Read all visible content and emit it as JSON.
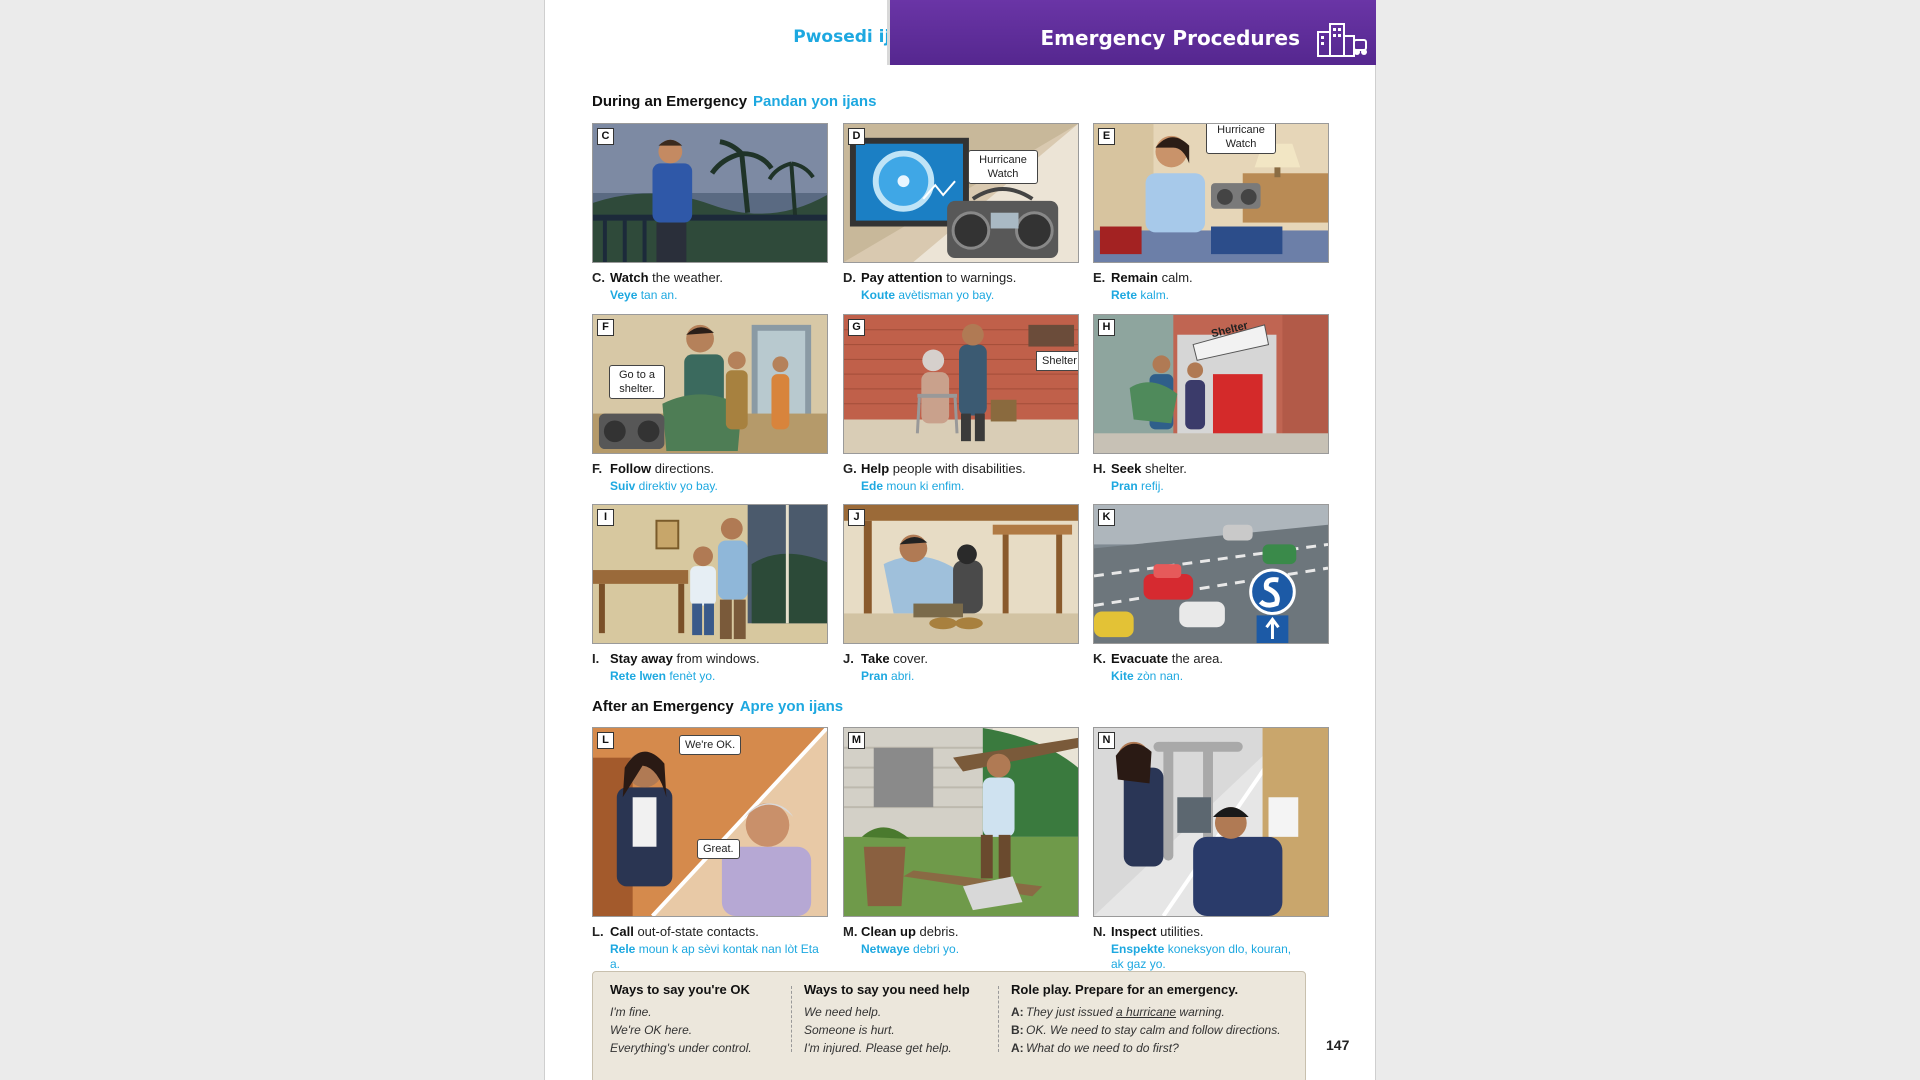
{
  "header": {
    "section_title_ht": "Pwosedi ijans",
    "section_title_en": "Emergency Procedures"
  },
  "during": {
    "title_en": "During an Emergency",
    "title_ht": "Pandan yon ijans"
  },
  "after": {
    "title_en": "After an Emergency",
    "title_ht": "Apre yon ijans"
  },
  "items": {
    "C": {
      "letter": "C",
      "label": "C.",
      "verb": "Watch",
      "rest": " the weather.",
      "verb_ht": "Veye",
      "rest_ht": " tan an."
    },
    "D": {
      "letter": "D",
      "label": "D.",
      "verb": "Pay attention",
      "rest": " to warnings.",
      "verb_ht": "Koute",
      "rest_ht": " avètisman yo bay.",
      "bubble": "Hurricane Watch"
    },
    "E": {
      "letter": "E",
      "label": "E.",
      "verb": "Remain",
      "rest": " calm.",
      "verb_ht": "Rete",
      "rest_ht": " kalm.",
      "bubble": "Hurricane Watch"
    },
    "F": {
      "letter": "F",
      "label": "F.",
      "verb": "Follow",
      "rest": " directions.",
      "verb_ht": "Suiv",
      "rest_ht": " direktiv yo bay.",
      "bubble": "Go to a shelter."
    },
    "G": {
      "letter": "G",
      "label": "G.",
      "verb": "Help",
      "rest": " people with disabilities.",
      "verb_ht": "Ede",
      "rest_ht": " moun ki enfim.",
      "sign": "Shelter"
    },
    "H": {
      "letter": "H",
      "label": "H.",
      "verb": "Seek",
      "rest": " shelter.",
      "verb_ht": "Pran",
      "rest_ht": " refij.",
      "sign": "Shelter"
    },
    "I": {
      "letter": "I",
      "label": "I.",
      "verb": "Stay away",
      "rest": " from windows.",
      "verb_ht": "Rete lwen",
      "rest_ht": " fenèt yo."
    },
    "J": {
      "letter": "J",
      "label": "J.",
      "verb": "Take",
      "rest": " cover.",
      "verb_ht": "Pran",
      "rest_ht": " abri."
    },
    "K": {
      "letter": "K",
      "label": "K.",
      "verb": "Evacuate",
      "rest": " the area.",
      "verb_ht": "Kite",
      "rest_ht": " zòn nan."
    },
    "L": {
      "letter": "L",
      "label": "L.",
      "verb": "Call",
      "rest": " out-of-state contacts.",
      "verb_ht": "Rele",
      "rest_ht": " moun k ap sèvi kontak nan lòt Eta a.",
      "bubble1": "We're OK.",
      "bubble2": "Great."
    },
    "M": {
      "letter": "M",
      "label": "M.",
      "verb": "Clean up",
      "rest": " debris.",
      "verb_ht": "Netwaye",
      "rest_ht": " debri yo."
    },
    "N": {
      "letter": "N",
      "label": "N.",
      "verb": "Inspect",
      "rest": " utilities.",
      "verb_ht": "Enspekte",
      "rest_ht": " koneksyon dlo, kouran, ak gaz yo."
    }
  },
  "talk": {
    "ok": {
      "title": "Ways to say you're OK",
      "lines": [
        "I'm fine.",
        "We're OK here.",
        "Everything's under control."
      ]
    },
    "help": {
      "title": "Ways to say you need help",
      "lines": [
        "We need help.",
        "Someone is hurt.",
        "I'm injured. Please get help."
      ]
    },
    "roleplay": {
      "title": "Role play. Prepare for an emergency.",
      "l1_sp": "A:",
      "l1_a": "They just issued ",
      "l1_u": "a hurricane",
      "l1_b": " warning.",
      "l2_sp": "B:",
      "l2": "OK. We need to stay calm and follow directions.",
      "l3_sp": "A:",
      "l3": "What do we need to do first?"
    }
  },
  "page_number": "147",
  "colors": {
    "accent_blue": "#1da8e0",
    "header_purple": "#5b2a95",
    "box_beige": "#ece7dc"
  }
}
